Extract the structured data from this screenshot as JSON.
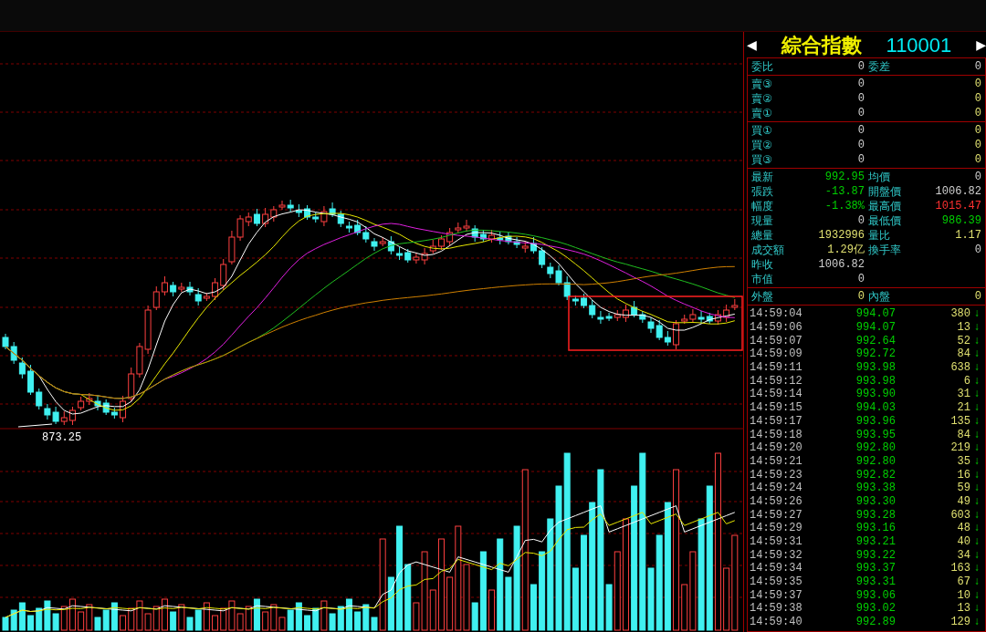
{
  "chart": {
    "low_label": "873.25"
  },
  "quote": {
    "title": "綜合指數",
    "code": "110001",
    "prev_arrow": "◀",
    "next_arrow": "▶"
  },
  "ratio": {
    "label": "委比",
    "value": "0",
    "label2": "委差",
    "value2": "0"
  },
  "sells": [
    {
      "label": "賣③",
      "price": "0",
      "volume": "0"
    },
    {
      "label": "賣②",
      "price": "0",
      "volume": "0"
    },
    {
      "label": "賣①",
      "price": "0",
      "volume": "0"
    }
  ],
  "buys": [
    {
      "label": "買①",
      "price": "0",
      "volume": "0"
    },
    {
      "label": "買②",
      "price": "0",
      "volume": "0"
    },
    {
      "label": "買③",
      "price": "0",
      "volume": "0"
    }
  ],
  "stats": [
    {
      "label": "最新",
      "value": {
        "text": "992.95",
        "color": "#00d000"
      },
      "label2": "均價",
      "value2": {
        "text": "0",
        "color": "#d0d0d0"
      }
    },
    {
      "label": "張跌",
      "value": {
        "text": "-13.87",
        "color": "#00d000"
      },
      "label2": "開盤價",
      "value2": {
        "text": "1006.82",
        "color": "#d0d0d0"
      }
    },
    {
      "label": "幅度",
      "value": {
        "text": "-1.38%",
        "color": "#00d000"
      },
      "label2": "最高價",
      "value2": {
        "text": "1015.47",
        "color": "#ff3030"
      }
    },
    {
      "label": "現量",
      "value": {
        "text": "0",
        "color": "#d0d0d0"
      },
      "label2": "最低價",
      "value2": {
        "text": "986.39",
        "color": "#00d000"
      }
    },
    {
      "label": "總量",
      "value": {
        "text": "1932996",
        "color": "#e0e070"
      },
      "label2": "量比",
      "value2": {
        "text": "1.17",
        "color": "#e0e070"
      }
    },
    {
      "label": "成交額",
      "value": {
        "text": "1.29亿",
        "color": "#e0e070"
      },
      "label2": "換手率",
      "value2": {
        "text": "0",
        "color": "#d0d0d0"
      }
    },
    {
      "label": "昨收",
      "value": {
        "text": "1006.82",
        "color": "#d0d0d0"
      }
    },
    {
      "label": "市值",
      "value": {
        "text": "0",
        "color": "#d0d0d0"
      }
    }
  ],
  "outer_inner": {
    "label": "外盤",
    "value": "0",
    "label2": "內盤",
    "value2": "0"
  },
  "ticks": [
    {
      "time": "14:59:04",
      "price": "994.07",
      "volume": "380",
      "dir": "↓"
    },
    {
      "time": "14:59:06",
      "price": "994.07",
      "volume": "13",
      "dir": "↓"
    },
    {
      "time": "14:59:07",
      "price": "992.64",
      "volume": "52",
      "dir": "↓"
    },
    {
      "time": "14:59:09",
      "price": "992.72",
      "volume": "84",
      "dir": "↓"
    },
    {
      "time": "14:59:11",
      "price": "993.98",
      "volume": "638",
      "dir": "↓"
    },
    {
      "time": "14:59:12",
      "price": "993.98",
      "volume": "6",
      "dir": "↓"
    },
    {
      "time": "14:59:14",
      "price": "993.90",
      "volume": "31",
      "dir": "↓"
    },
    {
      "time": "14:59:15",
      "price": "994.03",
      "volume": "21",
      "dir": "↓"
    },
    {
      "time": "14:59:17",
      "price": "993.96",
      "volume": "135",
      "dir": "↓"
    },
    {
      "time": "14:59:18",
      "price": "993.95",
      "volume": "84",
      "dir": "↓"
    },
    {
      "time": "14:59:20",
      "price": "992.80",
      "volume": "219",
      "dir": "↓"
    },
    {
      "time": "14:59:21",
      "price": "992.80",
      "volume": "35",
      "dir": "↓"
    },
    {
      "time": "14:59:23",
      "price": "992.82",
      "volume": "16",
      "dir": "↓"
    },
    {
      "time": "14:59:24",
      "price": "993.38",
      "volume": "59",
      "dir": "↓"
    },
    {
      "time": "14:59:26",
      "price": "993.30",
      "volume": "49",
      "dir": "↓"
    },
    {
      "time": "14:59:27",
      "price": "993.28",
      "volume": "603",
      "dir": "↓"
    },
    {
      "time": "14:59:29",
      "price": "993.16",
      "volume": "48",
      "dir": "↓"
    },
    {
      "time": "14:59:31",
      "price": "993.21",
      "volume": "40",
      "dir": "↓"
    },
    {
      "time": "14:59:32",
      "price": "993.22",
      "volume": "34",
      "dir": "↓"
    },
    {
      "time": "14:59:34",
      "price": "993.37",
      "volume": "163",
      "dir": "↓"
    },
    {
      "time": "14:59:35",
      "price": "993.31",
      "volume": "67",
      "dir": "↓"
    },
    {
      "time": "14:59:37",
      "price": "993.06",
      "volume": "10",
      "dir": "↓"
    },
    {
      "time": "14:59:38",
      "price": "993.02",
      "volume": "13",
      "dir": "↓"
    },
    {
      "time": "14:59:40",
      "price": "992.89",
      "volume": "129",
      "dir": "↓"
    }
  ]
}
